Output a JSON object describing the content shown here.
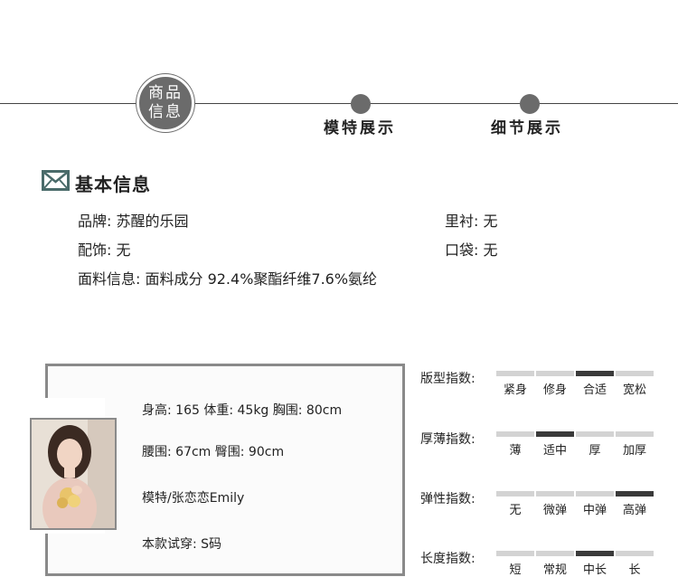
{
  "nav": {
    "current_line1": "商品",
    "current_line2": "信息",
    "tab_model": "模特展示",
    "tab_detail": "细节展示"
  },
  "basic": {
    "title": "基本信息",
    "brand": "品牌: 苏醒的乐园",
    "lining": "里衬: 无",
    "accessory": "配饰: 无",
    "pocket": "口袋: 无",
    "fabric": "面料信息: 面料成分 92.4%聚酯纤维7.6%氨纶"
  },
  "model": {
    "measure1": "身高: 165 体重: 45kg 胸围: 80cm",
    "measure2": "腰围: 67cm 臀围: 90cm",
    "name": "模特/张恋恋Emily",
    "size": "本款试穿: S码"
  },
  "indices": [
    {
      "label": "版型指数:",
      "options": [
        "紧身",
        "修身",
        "合适",
        "宽松"
      ],
      "selected": 2
    },
    {
      "label": "厚薄指数:",
      "options": [
        "薄",
        "适中",
        "厚",
        "加厚"
      ],
      "selected": 1
    },
    {
      "label": "弹性指数:",
      "options": [
        "无",
        "微弹",
        "中弹",
        "高弹"
      ],
      "selected": 3
    },
    {
      "label": "长度指数:",
      "options": [
        "短",
        "常规",
        "中长",
        "长"
      ],
      "selected": 2
    }
  ],
  "colors": {
    "accent": "#6b6b6b",
    "selected": "#3a3a3a",
    "unselected": "#d3d3d3"
  },
  "icons": {
    "section": "mail-icon"
  }
}
